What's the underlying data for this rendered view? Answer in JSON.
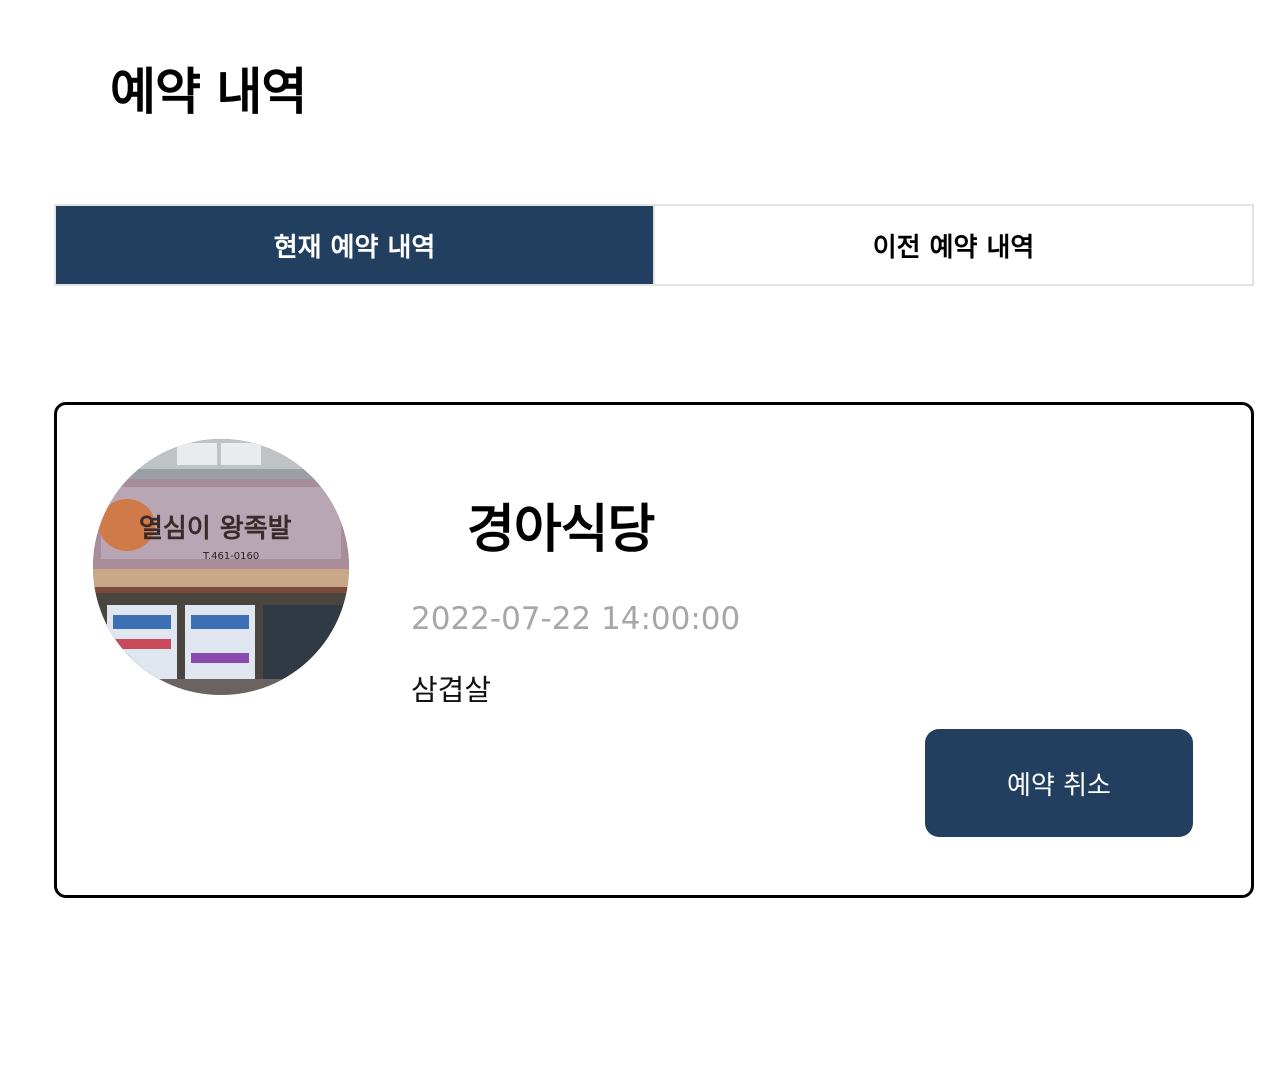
{
  "page": {
    "title": "예약 내역"
  },
  "tabs": [
    {
      "label": "현재 예약 내역",
      "active": true
    },
    {
      "label": "이전 예약 내역",
      "active": false
    }
  ],
  "reservation": {
    "restaurant_name": "경아식당",
    "datetime": "2022-07-22 14:00:00",
    "menu": "삼겹살",
    "cancel_label": "예약 취소",
    "photo_sign_text": "열심이 왕족발",
    "photo_sign_phone": "T.461-0160"
  },
  "colors": {
    "accent": "#223f5f",
    "datetime_text": "#a7a7a7",
    "tab_border": "#e3e3e3"
  }
}
